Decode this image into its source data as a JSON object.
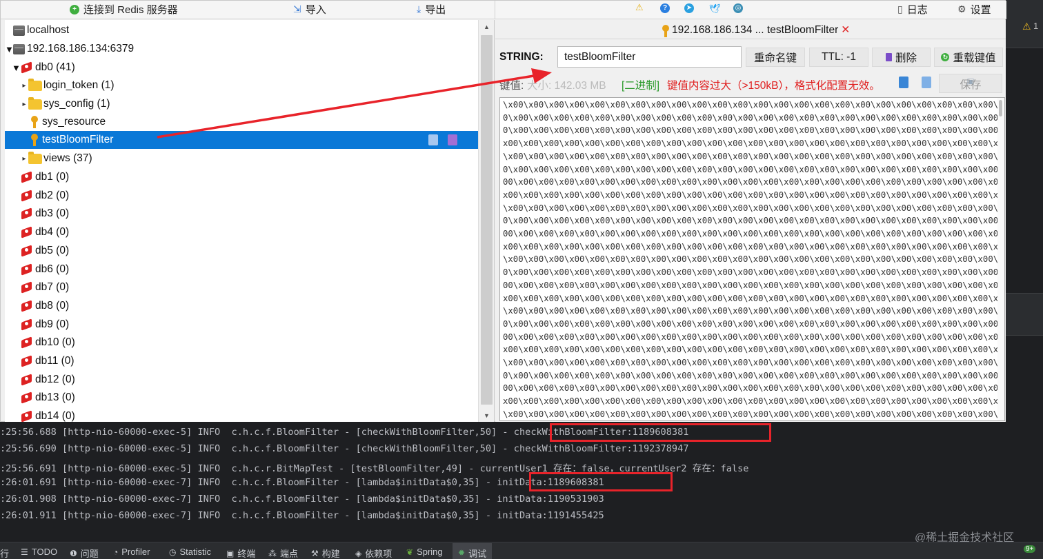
{
  "toolbar": {
    "connect_label": "连接到 Redis 服务器",
    "import_label": "导入",
    "export_label": "导出",
    "log_label": "日志",
    "settings_label": "设置"
  },
  "tree": {
    "localhost": "localhost",
    "server": "192.168.186.134:6379",
    "db0": "db0  (41)",
    "items": [
      {
        "label": "login_token (1)",
        "kind": "folder"
      },
      {
        "label": "sys_config (1)",
        "kind": "folder"
      },
      {
        "label": "sys_resource",
        "kind": "key"
      },
      {
        "label": "testBloomFilter",
        "kind": "key",
        "selected": true
      },
      {
        "label": "views (37)",
        "kind": "folder"
      }
    ],
    "dbs": [
      "db1  (0)",
      "db2  (0)",
      "db3  (0)",
      "db4  (0)",
      "db5  (0)",
      "db6  (0)",
      "db7  (0)",
      "db8  (0)",
      "db9  (0)",
      "db10  (0)",
      "db11  (0)",
      "db12  (0)",
      "db13  (0)",
      "db14  (0)"
    ]
  },
  "editor": {
    "tab_title": "192.168.186.134 ... testBloomFilter",
    "tab_close": "✕",
    "type_label": "STRING:",
    "key_value": "testBloomFilter",
    "rename_label": "重命名键",
    "ttl_label": "TTL:  -1",
    "delete_label": "删除",
    "reload_label": "重载键值",
    "value_label": "键值:",
    "size_label": "大小:  142.03 MB",
    "format_label": "[二进制]",
    "warning_text": "键值内容过大（>150kB），格式化配置无效。",
    "save_label": "保存",
    "value_lines": [
      "\\x00\\x00\\x00\\x00\\x00\\x00\\x00\\x00\\x00\\x00\\x00\\x00\\x00\\x00\\x00\\x00\\x00\\x00\\x00\\x00\\x00\\x00\\x00\\x00\\x00\\x0",
      "0\\x00\\x00\\x00\\x00\\x00\\x00\\x00\\x00\\x00\\x00\\x00\\x00\\x00\\x00\\x00\\x00\\x00\\x00\\x00\\x00\\x00\\x00\\x00\\x00\\x00\\",
      "0\\x00\\x00\\x00\\x00\\x00\\x00\\x00\\x00\\x00\\x00\\x00\\x00\\x00\\x00\\x00\\x00\\x00\\x00\\x00\\x00\\x00\\x00\\x00\\x00\\x00\\",
      "x00\\x00\\x00\\x00\\x00\\x00\\x00\\x00\\x00\\x00\\x00\\x00\\x00\\x00\\x00\\x00\\x00\\x00\\x00\\x00\\x00\\x00\\x00\\x00\\x00\\x00",
      "\\x00\\x00\\x00\\x00\\x00\\x00\\x00\\x00\\x00\\x00\\x00\\x00\\x00\\x00\\x00\\x00\\x00\\x00\\x00\\x00\\x00\\x00\\x00\\x00\\x00\\x0",
      "0\\x00\\x00\\x00\\x00\\x00\\x00\\x00\\x00\\x00\\x00\\x00\\x00\\x00\\x00\\x00\\x00\\x00\\x00\\x00\\x00\\x00\\x00\\x00\\x00\\x00\\",
      "00\\x00\\x00\\x00\\x00\\x00\\x00\\x00\\x00\\x00\\x00\\x00\\x00\\x00\\x00\\x00\\x00\\x00\\x00\\x00\\x00\\x00\\x00\\x00\\x00\\x00\\",
      "x00\\x00\\x00\\x00\\x00\\x00\\x00\\x00\\x00\\x00\\x00\\x00\\x00\\x00\\x00\\x00\\x00\\x00\\x00\\x00\\x00\\x00\\x00\\x00\\x00\\x00",
      "\\x00\\x00\\x00\\x00\\x00\\x00\\x00\\x00\\x00\\x00\\x00\\x00\\x00\\x00\\x00\\x00\\x00\\x00\\x00\\x00\\x00\\x00\\x00\\x00\\x00\\x0",
      "0\\x00\\x00\\x00\\x00\\x00\\x00\\x00\\x00\\x00\\x00\\x00\\x00\\x00\\x00\\x00\\x00\\x00\\x00\\x00\\x00\\x00\\x00\\x00\\x00\\x00\\",
      "00\\x00\\x00\\x00\\x00\\x00\\x00\\x00\\x00\\x00\\x00\\x00\\x00\\x00\\x00\\x00\\x00\\x00\\x00\\x00\\x00\\x00\\x00\\x00\\x00\\x00\\",
      "x00\\x00\\x00\\x00\\x00\\x00\\x00\\x00\\x00\\x00\\x00\\x00\\x00\\x00\\x00\\x00\\x00\\x00\\x00\\x00\\x00\\x00\\x00\\x00\\x00\\x00",
      "\\x00\\x00\\x00\\x00\\x00\\x00\\x00\\x00\\x00\\x00\\x00\\x00\\x00\\x00\\x00\\x00\\x00\\x00\\x00\\x00\\x00\\x00\\x00\\x00\\x00\\x0",
      "0\\x00\\x00\\x00\\x00\\x00\\x00\\x00\\x00\\x00\\x00\\x00\\x00\\x00\\x00\\x00\\x00\\x00\\x00\\x00\\x00\\x00\\x00\\x00\\x00\\x00\\",
      "00\\x00\\x00\\x00\\x00\\x00\\x00\\x00\\x00\\x00\\x00\\x00\\x00\\x00\\x00\\x00\\x00\\x00\\x00\\x00\\x00\\x00\\x00\\x00\\x00\\x00\\",
      "x00\\x00\\x00\\x00\\x00\\x00\\x00\\x00\\x00\\x00\\x00\\x00\\x00\\x00\\x00\\x00\\x00\\x00\\x00\\x00\\x00\\x00\\x00\\x00\\x00\\x00",
      "\\x00\\x00\\x00\\x00\\x00\\x00\\x00\\x00\\x00\\x00\\x00\\x00\\x00\\x00\\x00\\x00\\x00\\x00\\x00\\x00\\x00\\x00\\x00\\x00\\x00\\x0",
      "0\\x00\\x00\\x00\\x00\\x00\\x00\\x00\\x00\\x00\\x00\\x00\\x00\\x00\\x00\\x00\\x00\\x00\\x00\\x00\\x00\\x00\\x00\\x00\\x00\\x00\\",
      "00\\x00\\x00\\x00\\x00\\x00\\x00\\x00\\x00\\x00\\x00\\x00\\x00\\x00\\x00\\x00\\x00\\x00\\x00\\x00\\x00\\x00\\x00\\x00\\x00\\x00\\",
      "x00\\x00\\x00\\x00\\x00\\x00\\x00\\x00\\x00\\x00\\x00\\x00\\x00\\x00\\x00\\x00\\x00\\x00\\x00\\x00\\x00\\x00\\x00\\x00\\x00\\x00",
      "\\x00\\x00\\x00\\x00\\x00\\x00\\x00\\x00\\x00\\x00\\x00\\x00\\x00\\x00\\x00\\x00\\x00\\x00\\x00\\x00\\x00\\x00\\x00\\x00\\x00\\x0",
      "0\\x00\\x00\\x00\\x00\\x00\\x00\\x00\\x00\\x00\\x00\\x00\\x00\\x00\\x00\\x00\\x00\\x00\\x00\\x00\\x00\\x00\\x00\\x00\\x00\\x00\\",
      "00\\x00\\x00\\x00\\x00\\x00\\x00\\x00\\x00\\x00\\x00\\x00\\x00\\x00\\x00\\x00\\x00\\x00\\x00\\x00\\x00\\x00\\x00\\x00\\x00\\x00\\",
      "x00\\x00\\x00\\x00\\x00\\x00\\x00\\x00\\x00\\x00\\x00\\x00\\x00\\x00\\x00\\x00\\x00\\x00\\x00\\x00\\x00\\x00\\x00\\x00\\x00\\x00",
      "\\x00\\x00\\x00\\x00\\x00\\x00\\x00\\x00\\x00\\x00\\x00\\x00\\x00\\x00\\x00\\x00\\x00\\x00\\x00\\x00\\x00\\x00\\x00\\x00\\x00\\x0"
    ]
  },
  "console": {
    "lines": [
      {
        "text": ":25:56.688 [http-nio-60000-exec-5] INFO  c.h.c.f.BloomFilter - [checkWithBloomFilter,50] - ",
        "tail": "checkWithBloomFilter:1189608381"
      },
      {
        "text": ":25:56.690 [http-nio-60000-exec-5] INFO  c.h.c.f.BloomFilter - [checkWithBloomFilter,50] - checkWithBloomFilter:1192378947",
        "tail": ""
      },
      {
        "text": ":25:56.691 [http-nio-60000-exec-5] INFO  c.h.c.r.BitMapTest - [testBloomFilter,49] - currentUser1 存在：false，currentUser2 存在：false",
        "tail": ""
      },
      {
        "text": ":26:01.691 [http-nio-60000-exec-7] INFO  c.h.c.f.BloomFilter - [lambda$initData$0,35] - ",
        "tail": "initData:1189608381"
      },
      {
        "text": ":26:01.908 [http-nio-60000-exec-7] INFO  c.h.c.f.BloomFilter - [lambda$initData$0,35] - initData:1190531903",
        "tail": ""
      },
      {
        "text": ":26:01.911 [http-nio-60000-exec-7] INFO  c.h.c.f.BloomFilter - [lambda$initData$0,35] - initData:1191455425",
        "tail": ""
      }
    ]
  },
  "ide": {
    "warning_count": "1",
    "right_badge": "9+"
  },
  "watermark": "@稀土掘金技术社区",
  "statusbar": {
    "items": [
      "TODO",
      "问题",
      "Profiler",
      "Statistic",
      "终端",
      "端点",
      "构建",
      "依赖项",
      "Spring",
      "调试"
    ]
  },
  "colors": {
    "selection": "#0a78d7",
    "highlight": "#e8232a",
    "binary_tag": "#2a9a2a",
    "warning_text": "#e02020"
  }
}
